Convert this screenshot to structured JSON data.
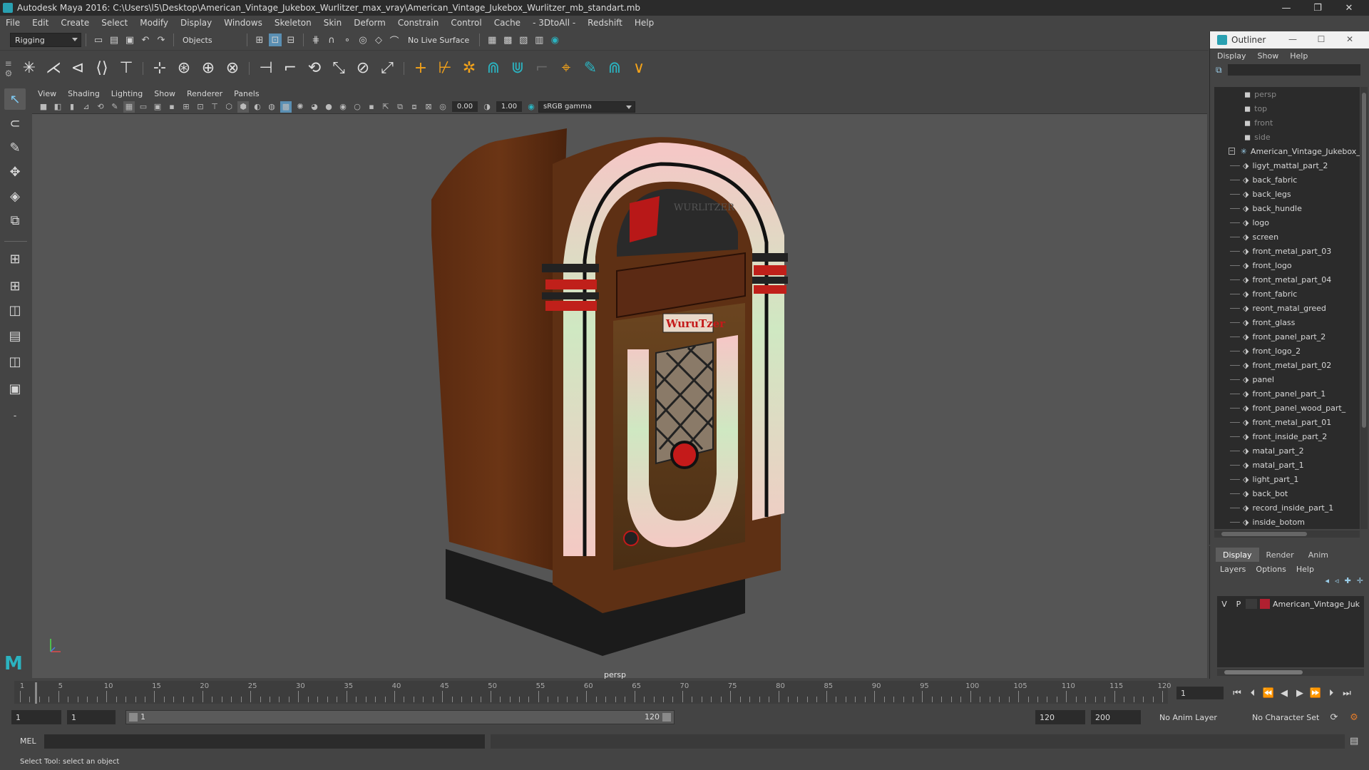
{
  "window": {
    "title": "Autodesk Maya 2016: C:\\Users\\l5\\Desktop\\American_Vintage_Jukebox_Wurlitzer_max_vray\\American_Vintage_Jukebox_Wurlitzer_mb_standart.mb",
    "minimize": "—",
    "restore": "❐",
    "close": "✕"
  },
  "menubar": [
    "File",
    "Edit",
    "Create",
    "Select",
    "Modify",
    "Display",
    "Windows",
    "Skeleton",
    "Skin",
    "Deform",
    "Constrain",
    "Control",
    "Cache",
    "- 3DtoAll -",
    "Redshift",
    "Help"
  ],
  "statusline": {
    "mode": "Rigging",
    "selection_mask": "Objects",
    "live_surface": "No Live Surface"
  },
  "viewport": {
    "menu": [
      "View",
      "Shading",
      "Lighting",
      "Show",
      "Renderer",
      "Panels"
    ],
    "exposure": "0.00",
    "gamma": "1.00",
    "color_space": "sRGB gamma",
    "camera": "persp",
    "model": {
      "logo_text": "WuruTzer",
      "top_text": "WURLITZER"
    }
  },
  "outliner": {
    "title": "Outliner",
    "menu": [
      "Display",
      "Show",
      "Help"
    ],
    "cameras": [
      "persp",
      "top",
      "front",
      "side"
    ],
    "group": "American_Vintage_Jukebox_",
    "children": [
      "ligyt_mattal_part_2",
      "back_fabric",
      "back_legs",
      "back_hundle",
      "logo",
      "screen",
      "front_metal_part_03",
      "front_logo",
      "front_metal_part_04",
      "front_fabric",
      "reont_matal_greed",
      "front_glass",
      "front_panel_part_2",
      "front_logo_2",
      "front_metal_part_02",
      "panel",
      "front_panel_part_1",
      "front_panel_wood_part_",
      "front_metal_part_01",
      "front_inside_part_2",
      "matal_part_2",
      "matal_part_1",
      "light_part_1",
      "back_bot",
      "record_inside_part_1",
      "inside_botom"
    ]
  },
  "layer_editor": {
    "tabs": [
      "Display",
      "Render",
      "Anim"
    ],
    "menu": [
      "Layers",
      "Options",
      "Help"
    ],
    "layer": {
      "visible": "V",
      "playback": "P",
      "name": "American_Vintage_Juk",
      "color": "#b02030"
    }
  },
  "timeline": {
    "labels": [
      "1",
      "5",
      "10",
      "15",
      "20",
      "25",
      "30",
      "35",
      "40",
      "45",
      "50",
      "55",
      "60",
      "65",
      "70",
      "75",
      "80",
      "85",
      "90",
      "95",
      "100",
      "105",
      "110",
      "115",
      "120"
    ],
    "current_frame": "1"
  },
  "range": {
    "start": "1",
    "playback_start": "1",
    "slider_start": "1",
    "slider_end": "120",
    "playback_end": "120",
    "end": "200",
    "anim_layer": "No Anim Layer",
    "character_set": "No Character Set"
  },
  "command": {
    "language": "MEL"
  },
  "help_line": "Select Tool: select an object",
  "colors": {
    "accent": "#29a0b1",
    "background": "#444444",
    "viewport": "#555555"
  }
}
